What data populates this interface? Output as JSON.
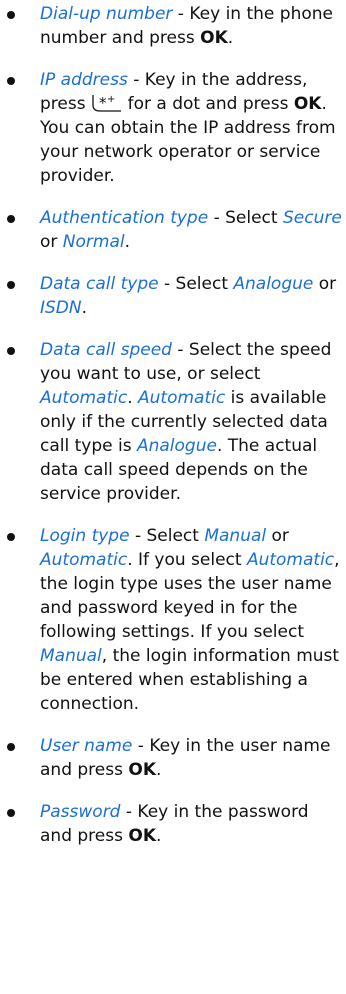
{
  "colors": {
    "term": "#1a6fd6",
    "text": "#111111"
  },
  "items": [
    {
      "term": "Dial-up number",
      "t1": " - Key in the phone number and press ",
      "b1": "OK",
      "t2": "."
    },
    {
      "term": "IP address",
      "t1": " - Key in the address, press",
      "icon": "star-plus-key-icon",
      "t2": "for a dot and press ",
      "b1": "OK",
      "t3": ". You can obtain the IP address from your network operator or service provider."
    },
    {
      "term": "Authentication type",
      "t1": " - Select ",
      "o1": "Secure",
      "t2": " or ",
      "o2": "Normal",
      "t3": "."
    },
    {
      "term": "Data call type",
      "t1": " - Select ",
      "o1": "Analogue",
      "t2": " or ",
      "o2": "ISDN",
      "t3": "."
    },
    {
      "term": "Data call speed",
      "t1": " - Select the speed you want to use, or select ",
      "o1": "Automatic",
      "t2": ". ",
      "o2": "Automatic",
      "t3": " is available only if the currently selected data call type is ",
      "o3": "Analogue",
      "t4": ". The actual data call speed depends on the service provider."
    },
    {
      "term": "Login type",
      "t1": " - Select ",
      "o1": "Manual",
      "t2": " or ",
      "o2": "Automatic",
      "t3": ". If you select ",
      "o3": "Automatic",
      "t4": ", the login type uses the user name and password keyed in for the following settings. If you select ",
      "o4": "Manual",
      "t5": ", the login information must be entered when establishing a connection."
    },
    {
      "term": "User name",
      "t1": " - Key in the user name and press ",
      "b1": "OK",
      "t2": "."
    },
    {
      "term": "Password",
      "t1": " - Key in the password and press ",
      "b1": "OK",
      "t2": "."
    }
  ]
}
